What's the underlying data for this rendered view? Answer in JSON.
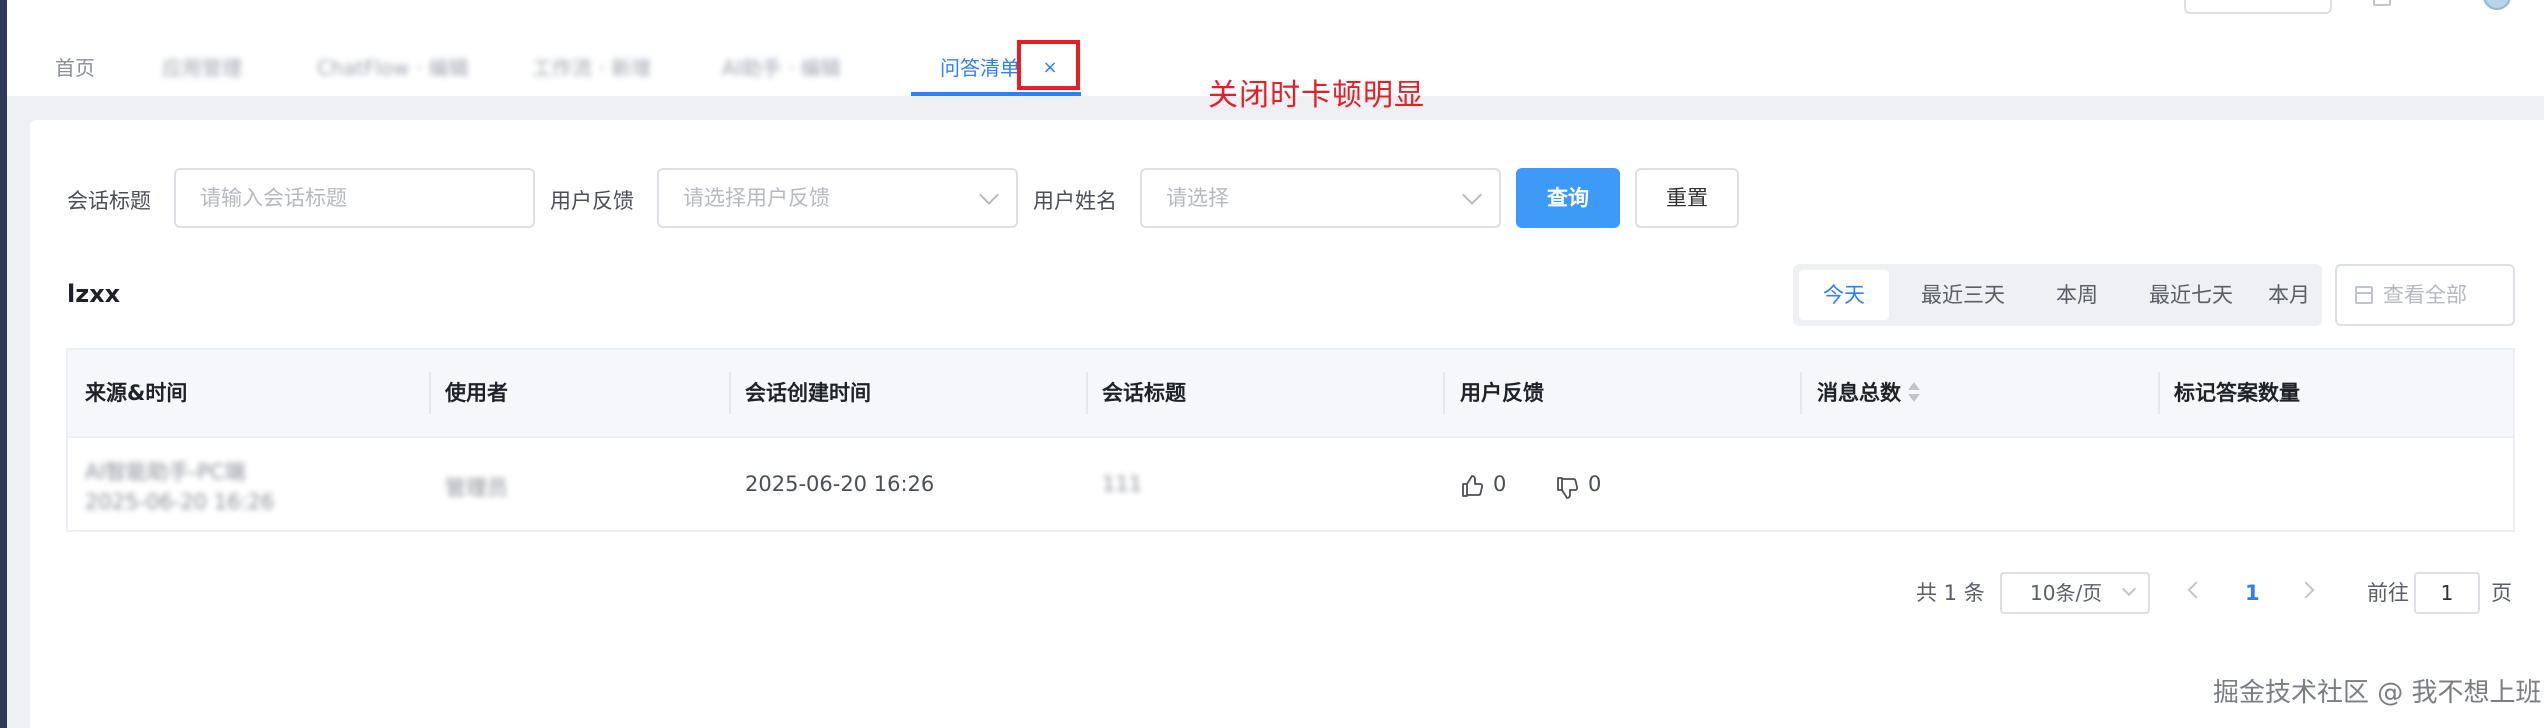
{
  "tabs": [
    {
      "label": "首页",
      "blurred": false
    },
    {
      "label": "应用管理",
      "blurred": true
    },
    {
      "label": "ChatFlow · 编辑",
      "blurred": true
    },
    {
      "label": "工作流 · 新增",
      "blurred": true
    },
    {
      "label": "AI助手 · 编辑",
      "blurred": true
    },
    {
      "label": "问答清单",
      "blurred": false,
      "active": true
    }
  ],
  "tab_close_glyph": "×",
  "annotation": "关闭时卡顿明显",
  "filters": {
    "title_label": "会话标题",
    "title_placeholder": "请输入会话标题",
    "feedback_label": "用户反馈",
    "feedback_placeholder": "请选择用户反馈",
    "username_label": "用户姓名",
    "username_placeholder": "请选择",
    "query_button": "查询",
    "reset_button": "重置"
  },
  "section_title": "lzxx",
  "date_ranges": [
    "今天",
    "最近三天",
    "本周",
    "最近七天",
    "本月"
  ],
  "date_range_selected": "今天",
  "view_all": "查看全部",
  "table": {
    "columns": [
      "来源&时间",
      "使用者",
      "会话创建时间",
      "会话标题",
      "用户反馈",
      "消息总数",
      "标记答案数量"
    ],
    "rows": [
      {
        "source": "AI智能助手-PC端",
        "source_time": "2025-06-20 16:26",
        "user": "管理员",
        "created": "2025-06-20 16:26",
        "title": "111",
        "likes": "0",
        "dislikes": "0"
      }
    ]
  },
  "pagination": {
    "total": "共 1 条",
    "page_size": "10条/页",
    "current_page": "1",
    "goto_prefix": "前往",
    "goto_value": "1",
    "goto_suffix": "页"
  },
  "watermark": "掘金技术社区 @ 我不想上班",
  "colors": {
    "accent": "#2f7ff5",
    "primary_button": "#3d9af7",
    "annotation": "#e81d25"
  }
}
